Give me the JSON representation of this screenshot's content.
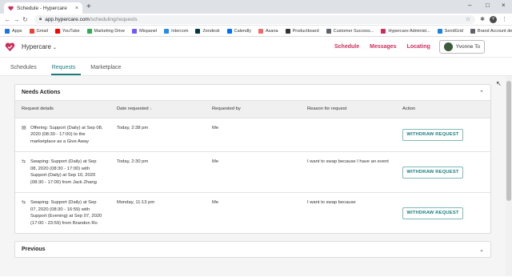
{
  "browser": {
    "tab_title": "Schedule - Hypercare",
    "url_domain": "app.hypercare.com",
    "url_path": "/scheduling/requests",
    "profile_initial": "Y",
    "bookmarks": [
      {
        "label": "Apps",
        "color": "#1a73e8"
      },
      {
        "label": "Gmail",
        "color": "#ea4335"
      },
      {
        "label": "YouTube",
        "color": "#ff0000"
      },
      {
        "label": "Marketing Drive",
        "color": "#34a853"
      },
      {
        "label": "Mixpanel",
        "color": "#7856ff"
      },
      {
        "label": "Intercom",
        "color": "#1f8ded"
      },
      {
        "label": "Zendesk",
        "color": "#03363d"
      },
      {
        "label": "Calendly",
        "color": "#006bff"
      },
      {
        "label": "Asana",
        "color": "#f06a6a"
      },
      {
        "label": "Productboard",
        "color": "#333333"
      },
      {
        "label": "Customer Success...",
        "color": "#5f6368"
      },
      {
        "label": "Hypercare Administ...",
        "color": "#cc2e5c"
      },
      {
        "label": "SendGrid",
        "color": "#1a82e2"
      },
      {
        "label": "Brand Account deta...",
        "color": "#5f6368"
      }
    ]
  },
  "header": {
    "brand": "Hypercare",
    "nav": [
      "Schedule",
      "Messages",
      "Locating"
    ],
    "user_name": "Yvonne To",
    "accent": "#cc2e5c"
  },
  "subtabs": [
    {
      "label": "Schedules",
      "active": false
    },
    {
      "label": "Requests",
      "active": true
    },
    {
      "label": "Marketplace",
      "active": false
    }
  ],
  "needs_actions": {
    "title": "Needs Actions",
    "columns": [
      "Request details",
      "Date requested",
      "Requested by",
      "Reason for request",
      "Action"
    ],
    "rows": [
      {
        "icon": "marketplace-icon",
        "details": "Offering: Support (Daily) at Sep 08, 2020 (08:30 - 17:00) to the marketplace as a Give Away",
        "date": "Today, 2:38 pm",
        "by": "Me",
        "reason": "",
        "action": "WITHDRAW REQUEST"
      },
      {
        "icon": "swap-icon",
        "details": "Swaping: Support (Daily) at Sep 08, 2020 (08:30 - 17:00) with Support (Daily) at Sep 10, 2020 (08:30 - 17:00) from Jack Zhang",
        "date": "Today, 2:30 pm",
        "by": "Me",
        "reason": "I want to swap because I have an event",
        "action": "WITHDRAW REQUEST"
      },
      {
        "icon": "swap-icon",
        "details": "Swaping: Support (Daily) at Sep 07, 2020 (08:30 - 16:59) with Support (Evening) at Sep 07, 2020 (17:00 - 23:59) from Brandon Ro",
        "date": "Monday, 11:13 pm",
        "by": "Me",
        "reason": "I want to swap because",
        "action": "WITHDRAW REQUEST"
      }
    ]
  },
  "previous": {
    "title": "Previous"
  }
}
